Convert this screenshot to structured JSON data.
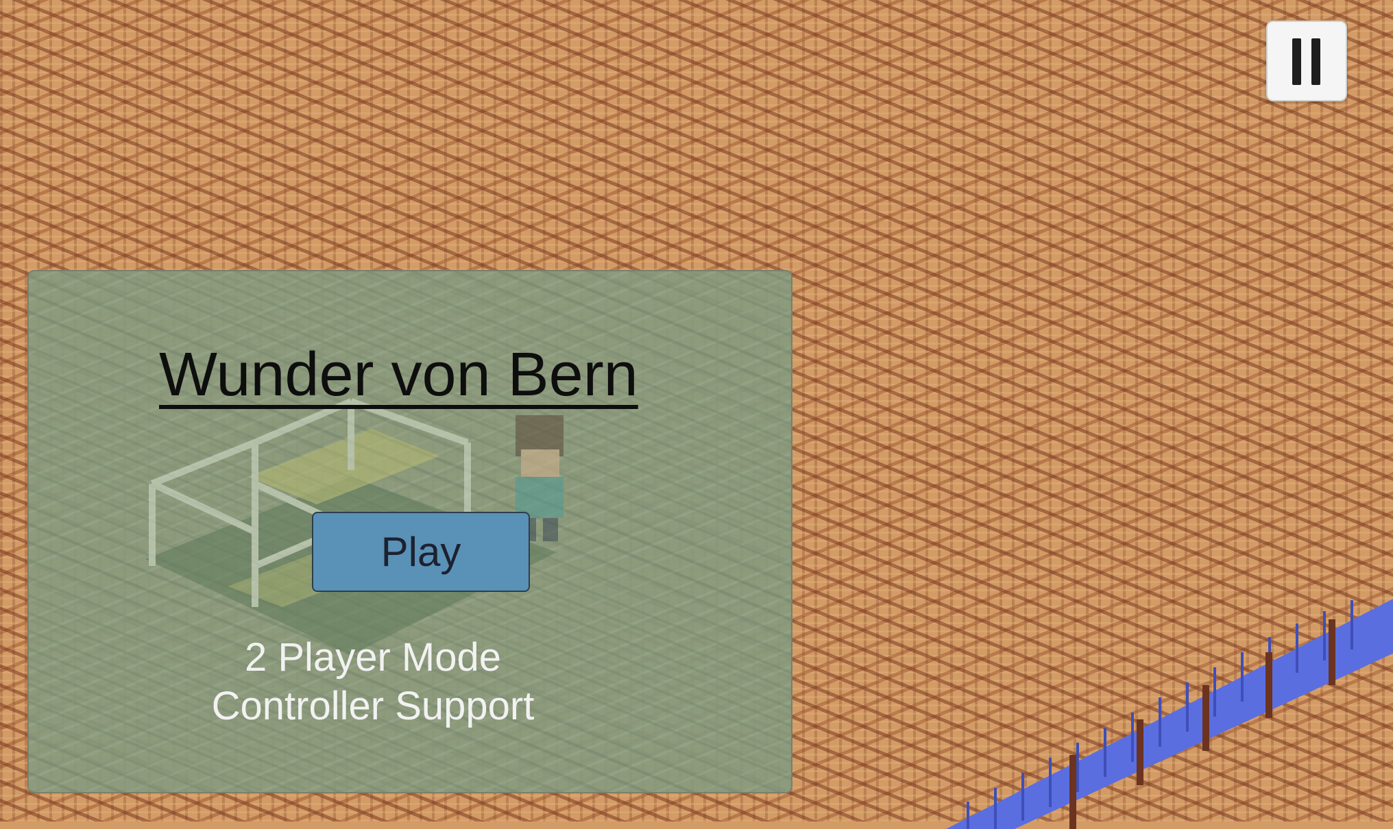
{
  "menu": {
    "title": "Wunder von Bern",
    "play_label": "Play",
    "info_line_1": "2 Player Mode",
    "info_line_2": "Controller Support"
  },
  "hud": {
    "pause_icon": "pause-icon"
  },
  "colors": {
    "ground": "#d39b65",
    "ground_dark": "#7a3a22",
    "panel": "#859a7e",
    "play_button": "#5a91b7",
    "barrier_blue": "#5a6ee0",
    "barrier_post": "#6b3320"
  }
}
